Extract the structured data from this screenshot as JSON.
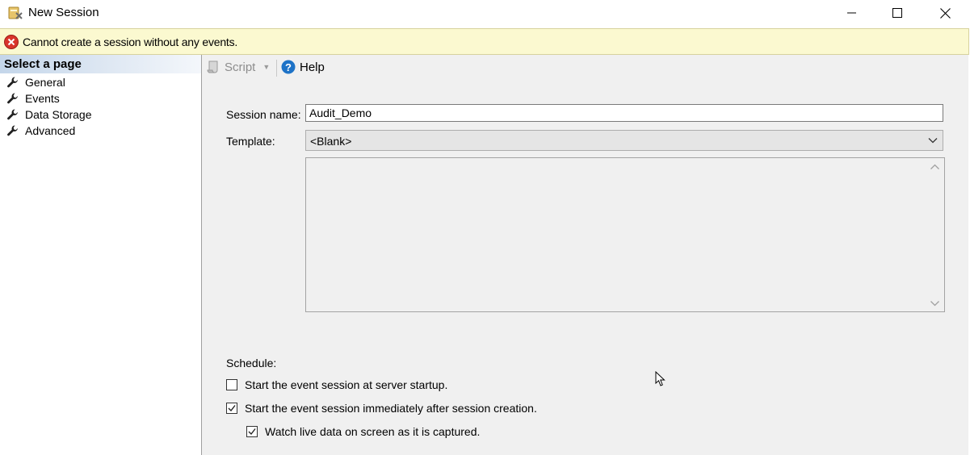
{
  "window": {
    "title": "New Session",
    "controls": [
      "minimize",
      "maximize",
      "close"
    ]
  },
  "banner": {
    "icon": "error-icon",
    "message": "Cannot create a session without any events."
  },
  "sidebar": {
    "header": "Select a page",
    "items": [
      {
        "label": "General",
        "icon": "wrench-icon"
      },
      {
        "label": "Events",
        "icon": "wrench-icon"
      },
      {
        "label": "Data Storage",
        "icon": "wrench-icon"
      },
      {
        "label": "Advanced",
        "icon": "wrench-icon"
      }
    ]
  },
  "toolbar": {
    "script_label": "Script",
    "help_label": "Help"
  },
  "form": {
    "session_name_label": "Session name:",
    "session_name_value": "Audit_Demo",
    "template_label": "Template:",
    "template_value": "<Blank>",
    "template_description": ""
  },
  "schedule": {
    "label": "Schedule:",
    "options": [
      {
        "label": "Start the event session at server startup.",
        "checked": false
      },
      {
        "label": "Start the event session immediately after session creation.",
        "checked": true
      },
      {
        "label": "Watch live data on screen as it is captured.",
        "checked": true
      }
    ]
  },
  "colors": {
    "banner_bg": "#fbf9d0",
    "error_red": "#d9342b",
    "help_blue": "#1e73c7",
    "header_gradient_start": "#c4d6ea"
  }
}
